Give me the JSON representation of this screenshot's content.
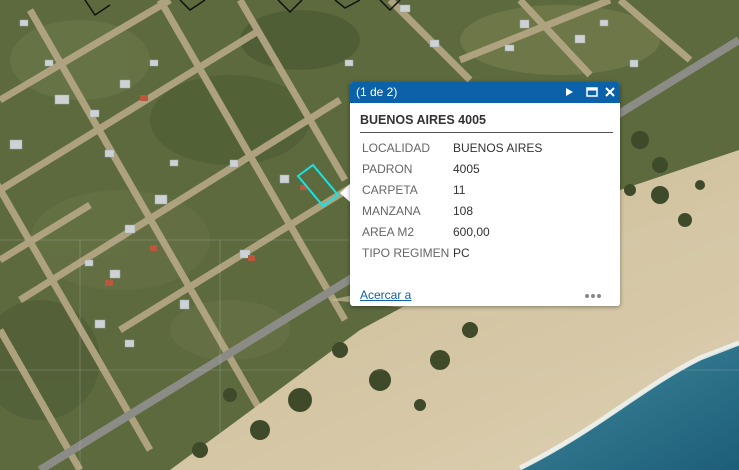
{
  "map": {
    "highlight_color": "#17e3e3"
  },
  "popup": {
    "counter": "(1 de 2)",
    "title": "BUENOS AIRES 4005",
    "fields": [
      {
        "label": "LOCALIDAD",
        "value": "BUENOS AIRES"
      },
      {
        "label": "PADRON",
        "value": "4005"
      },
      {
        "label": "CARPETA",
        "value": "11"
      },
      {
        "label": "MANZANA",
        "value": "108"
      },
      {
        "label": "AREA M2",
        "value": "600,00"
      },
      {
        "label": "TIPO REGIMEN",
        "value": "PC"
      }
    ],
    "zoom_link": "Acercar a",
    "header_color": "#0c62a8",
    "icons": {
      "next": "play-next-icon",
      "maximize": "maximize-icon",
      "close": "close-icon",
      "more": "ellipsis-icon"
    }
  }
}
